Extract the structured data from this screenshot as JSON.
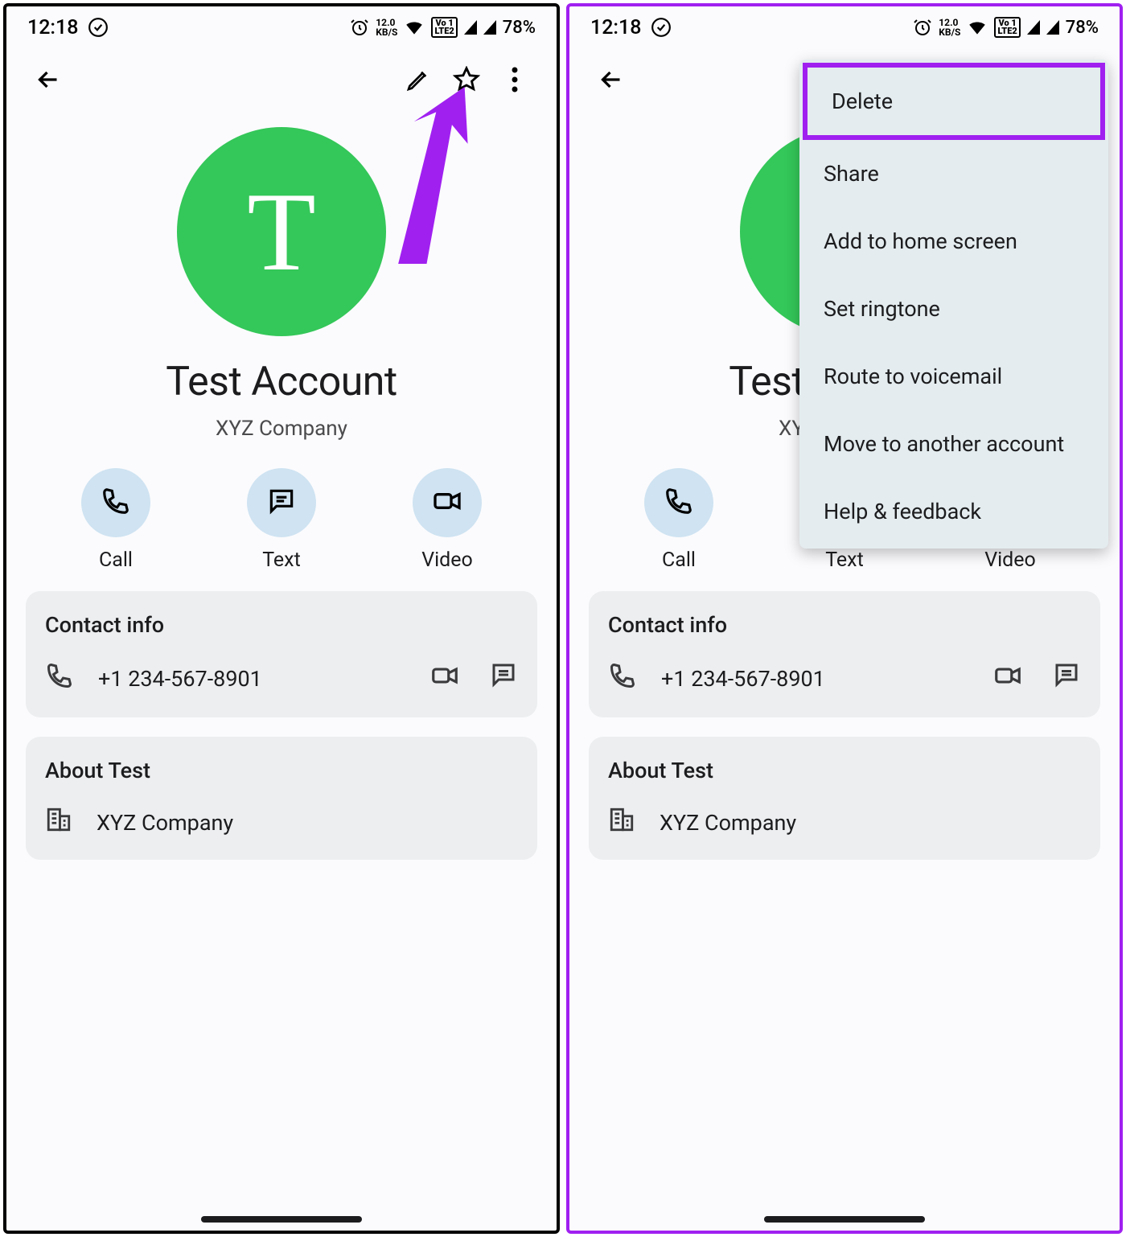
{
  "status": {
    "time": "12:18",
    "kbps_top": "12.0",
    "kbps_bot": "KB/S",
    "vo_top": "Vo 1",
    "vo_bot": "LTE2",
    "battery": "78%"
  },
  "contact": {
    "avatar_letter": "T",
    "name": "Test Account",
    "name_short": "Test",
    "company": "XYZ Company"
  },
  "actions": {
    "call": "Call",
    "text": "Text",
    "video": "Video"
  },
  "contact_info": {
    "title": "Contact info",
    "phone": "+1 234-567-8901"
  },
  "about": {
    "title": "About Test",
    "company": "XYZ Company"
  },
  "menu": {
    "items": [
      "Delete",
      "Share",
      "Add to home screen",
      "Set ringtone",
      "Route to voicemail",
      "Move to another account",
      "Help & feedback"
    ]
  }
}
